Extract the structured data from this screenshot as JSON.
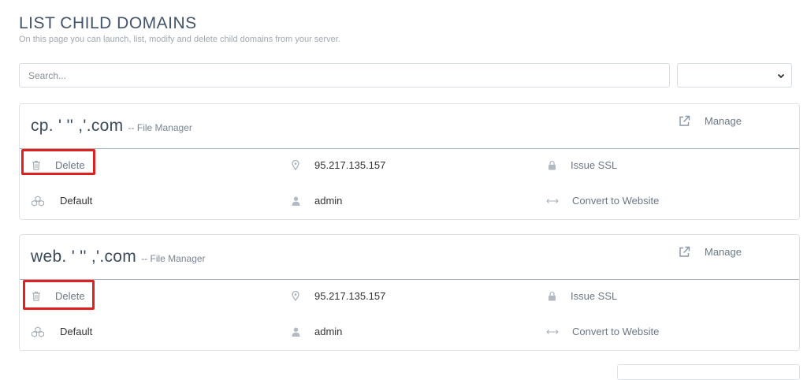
{
  "header": {
    "title": "LIST CHILD DOMAINS",
    "subtitle": "On this page you can launch, list, modify and delete child domains from your server."
  },
  "search": {
    "placeholder": "Search...",
    "value": ""
  },
  "filter": {
    "selected": ""
  },
  "domains": [
    {
      "name": "cp. '        '' ,'.com",
      "file_manager": "-- File Manager",
      "manage": "Manage",
      "delete": "Delete",
      "ip": "95.217.135.157",
      "ssl": "Issue SSL",
      "php": "Default",
      "owner": "admin",
      "convert": "Convert to Website"
    },
    {
      "name": "web. '        '' ,'.com",
      "file_manager": "-- File Manager",
      "manage": "Manage",
      "delete": "Delete",
      "ip": "95.217.135.157",
      "ssl": "Issue SSL",
      "php": "Default",
      "owner": "admin",
      "convert": "Convert to Website"
    }
  ],
  "colors": {
    "highlight": "#e0201e",
    "muted_text": "#6b7784",
    "border": "#dfe3e8"
  }
}
